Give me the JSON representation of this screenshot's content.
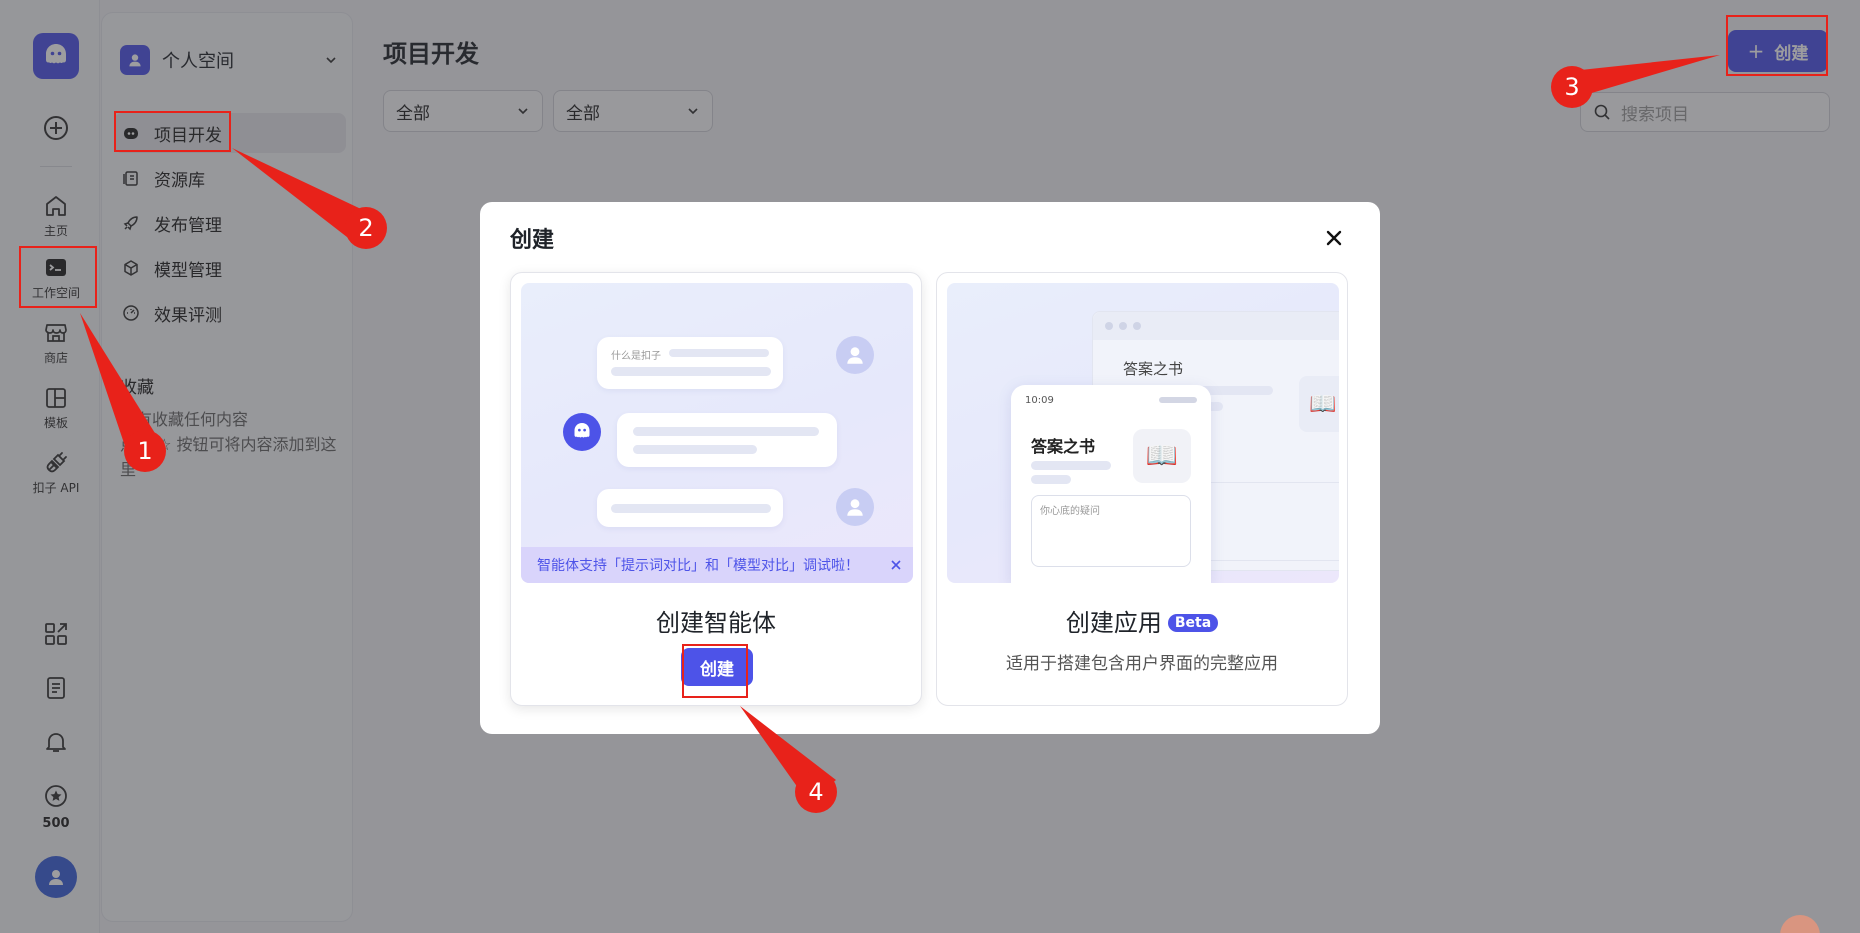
{
  "rail": {
    "home": "主页",
    "workspace": "工作空间",
    "store": "商店",
    "templates": "模板",
    "api": "扣子 API",
    "points": "500"
  },
  "nav": {
    "space_name": "个人空间",
    "items": [
      "项目开发",
      "资源库",
      "发布管理",
      "模型管理",
      "效果评测"
    ],
    "favorites_title": "收藏",
    "favorites_hint": "没有收藏任何内容\n点击 ☆ 按钮可将内容添加到这里"
  },
  "main": {
    "title": "项目开发",
    "filter1": "全部",
    "filter2": "全部",
    "create_label": "创建",
    "search_placeholder": "搜索项目"
  },
  "modal": {
    "title": "创建",
    "card1": {
      "name": "创建智能体",
      "button": "创建",
      "banner": "智能体支持「提示词对比」和「模型对比」调试啦！",
      "bubble_text": "什么是扣子"
    },
    "card2": {
      "name": "创建应用",
      "badge": "Beta",
      "desc": "适用于搭建包含用户界面的完整应用",
      "book_title": "答案之书",
      "book_title_back": "答案之书",
      "time": "10:09",
      "input_hint": "你心底的疑问"
    }
  },
  "annotations": [
    "1",
    "2",
    "3",
    "4"
  ],
  "colors": {
    "accent": "#4d53e8",
    "annotation": "#e8221a"
  }
}
